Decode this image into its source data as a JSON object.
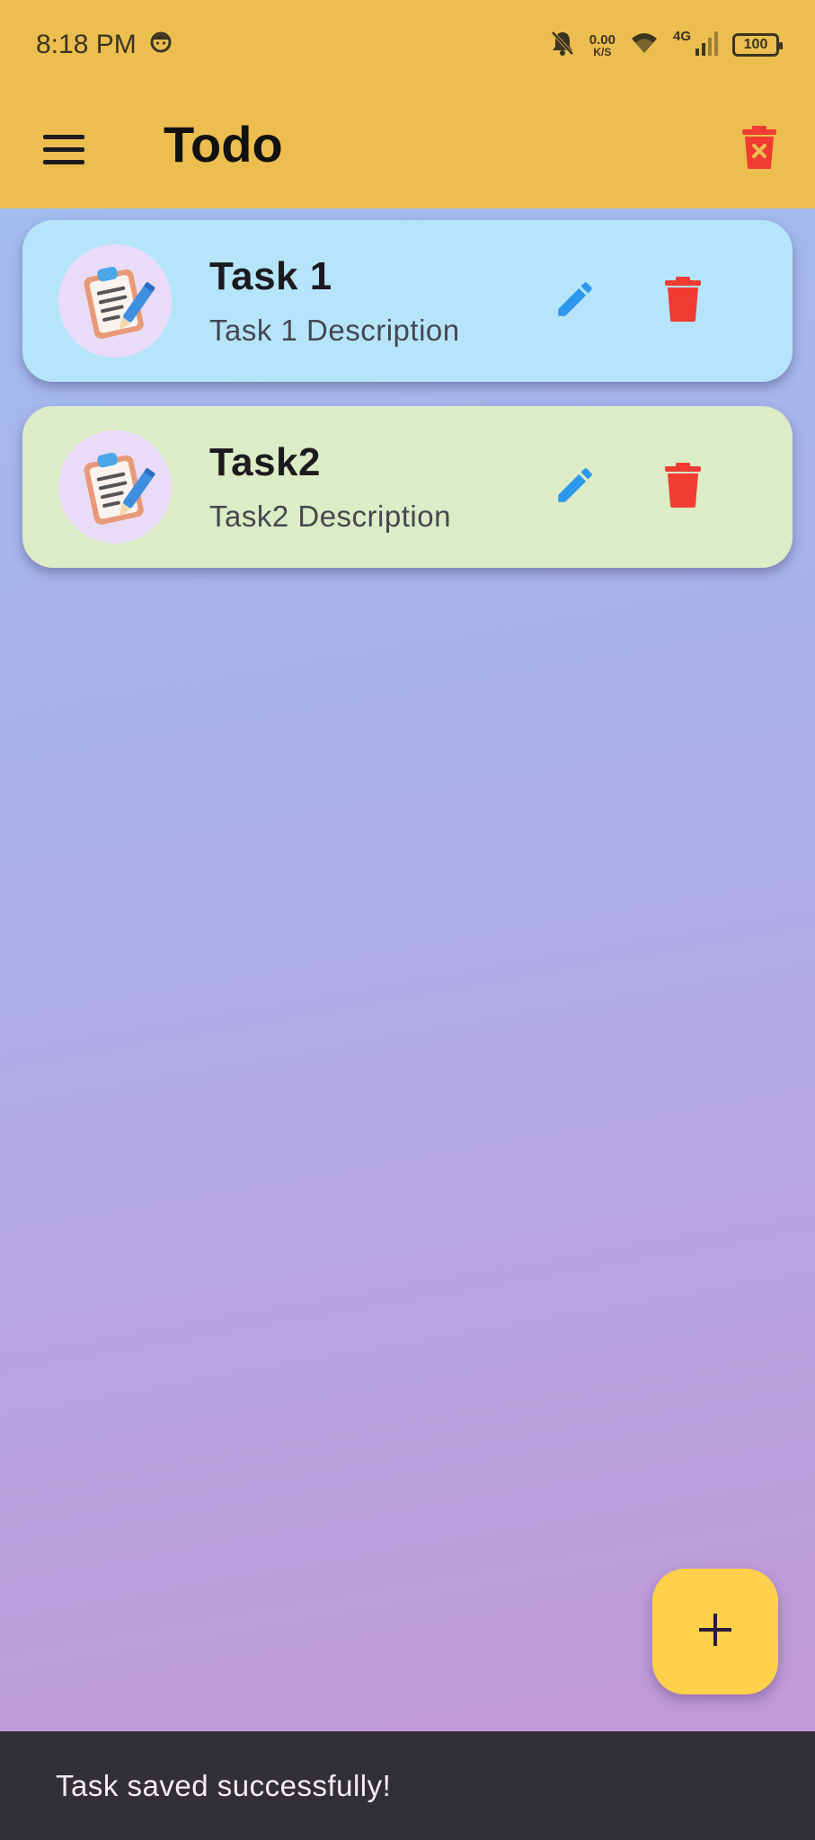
{
  "status_bar": {
    "time": "8:18 PM",
    "net_speed_value": "0.00",
    "net_speed_unit": "K/S",
    "network_type": "4G",
    "battery": "100"
  },
  "app_bar": {
    "title": "Todo",
    "menu_icon": "hamburger-menu-icon",
    "clear_icon": "delete-sweep-icon"
  },
  "tasks": [
    {
      "title": "Task 1",
      "description": "Task 1 Description",
      "color": "#b6e5fb"
    },
    {
      "title": "Task2",
      "description": "Task2 Description",
      "color": "#dcecc6"
    }
  ],
  "colors": {
    "app_bar": "#ebbe4f",
    "edit_icon": "#2c97ee",
    "delete_icon": "#f03c32",
    "fab": "#fed04b",
    "snackbar": "#322f35"
  },
  "fab": {
    "icon": "plus-icon"
  },
  "snackbar": {
    "message": "Task saved successfully!"
  }
}
